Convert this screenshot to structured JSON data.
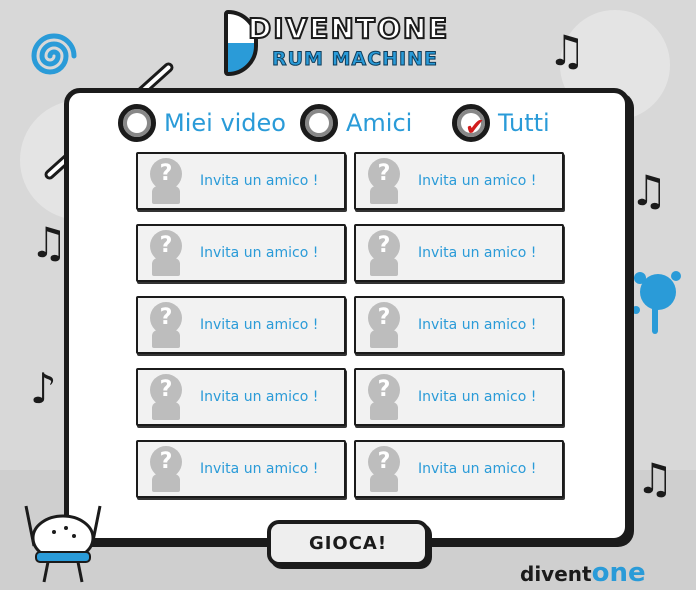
{
  "logo": {
    "line1": "DIVENTONE",
    "line2": "RUM MACHINE"
  },
  "tabs": [
    {
      "label": "Miei video",
      "checked": false
    },
    {
      "label": "Amici",
      "checked": false
    },
    {
      "label": "Tutti",
      "checked": true
    }
  ],
  "friend_slots": [
    {
      "label": "Invita un amico !"
    },
    {
      "label": "Invita un amico !"
    },
    {
      "label": "Invita un amico !"
    },
    {
      "label": "Invita un amico !"
    },
    {
      "label": "Invita un amico !"
    },
    {
      "label": "Invita un amico !"
    },
    {
      "label": "Invita un amico !"
    },
    {
      "label": "Invita un amico !"
    },
    {
      "label": "Invita un amico !"
    },
    {
      "label": "Invita un amico !"
    }
  ],
  "play_button": {
    "label": "GIOCA!"
  },
  "brand": {
    "part1": "divent",
    "part2": "one"
  },
  "colors": {
    "accent": "#2a9bd8",
    "check": "#d21c1c",
    "ink": "#1b1b1b"
  },
  "icons": {
    "avatar": "question-mark-avatar-icon",
    "checkmark": "checkmark-icon",
    "note": "music-note-icon",
    "swirl": "swirl-icon"
  }
}
